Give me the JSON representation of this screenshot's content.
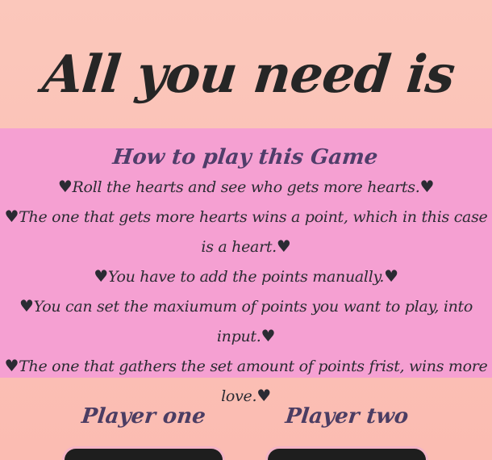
{
  "title": "All you need is love",
  "rules": {
    "heading": "How to play this Game",
    "heart": "♥",
    "items": [
      "Roll the hearts and see who gets more hearts.",
      "The one that gets more hearts wins a point, which in this case is a heart.",
      "You have to add the points manually.",
      "You can set the maxiumum of points you want to play, into input.",
      "The one that gathers the set amount of points frist, wins more love."
    ]
  },
  "players": [
    {
      "name": "Player one"
    },
    {
      "name": "Player two"
    }
  ],
  "colors": {
    "background": "#fbc7bb",
    "rules_panel": "#f5a0d2",
    "heading_text": "#503d6a",
    "dice_box": "#1e1e1e"
  }
}
